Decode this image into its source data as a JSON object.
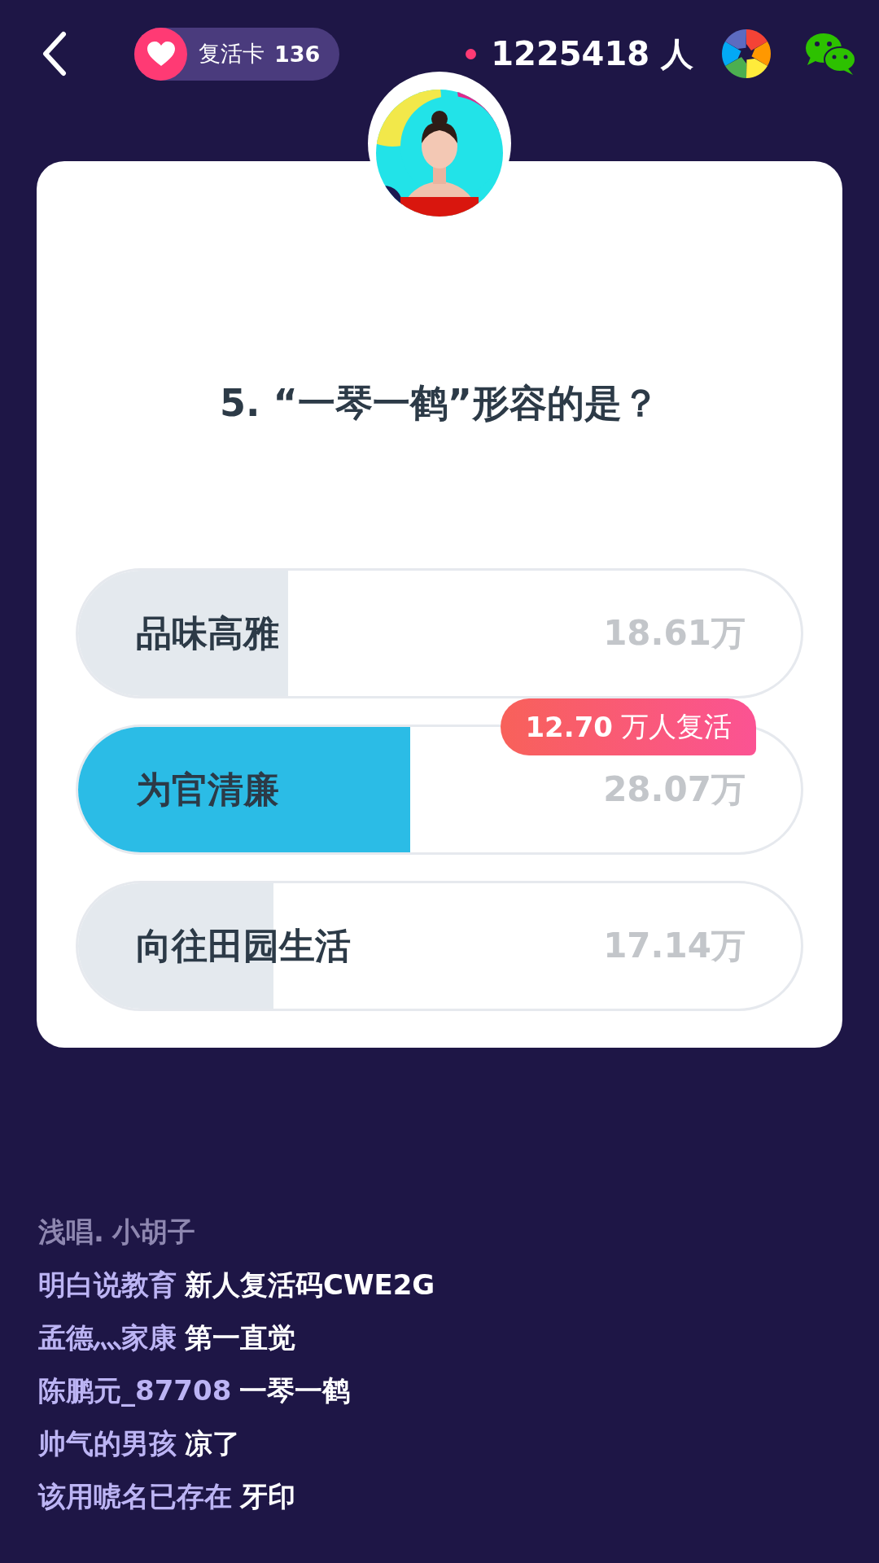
{
  "top_bar": {
    "revive_label": "复活卡",
    "revive_count": "136",
    "online_count": "1225418 人"
  },
  "question": "5. “一琴一鹤”形容的是？",
  "options": [
    {
      "label": "品味高雅",
      "count": "18.61万",
      "level": 0.29,
      "selected": false
    },
    {
      "label": "为官清廉",
      "count": "28.07万",
      "level": 0.46,
      "selected": true,
      "badge": "**12.70** 万人复活"
    },
    {
      "label": "向往田园生活",
      "count": "17.14万",
      "level": 0.27,
      "selected": false
    }
  ],
  "comments": [
    {
      "user": "浅唱.",
      "message": "小胡子",
      "faded": true
    },
    {
      "user": "明白说教育",
      "message": "新人复活码CWE2G",
      "faded": false
    },
    {
      "user": "孟德灬家康",
      "message": "第一直觉",
      "faded": false
    },
    {
      "user": "陈鹏元_87708",
      "message": "一琴一鹤",
      "faded": false
    },
    {
      "user": "帅气的男孩",
      "message": "凉了",
      "faded": false
    },
    {
      "user": "该用唬名已存在",
      "message": "牙印",
      "faded": false
    }
  ]
}
